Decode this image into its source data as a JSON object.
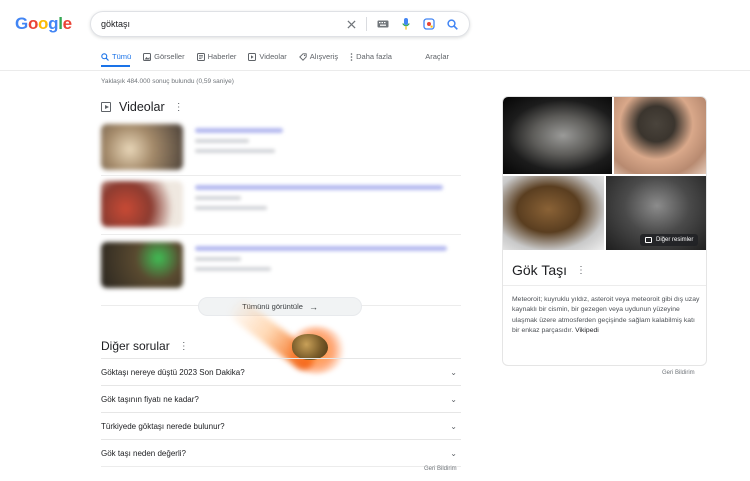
{
  "logo": {
    "letters": [
      "G",
      "o",
      "o",
      "g",
      "l",
      "e"
    ]
  },
  "search": {
    "query": "göktaşı"
  },
  "tabs": [
    {
      "label": "Tümü",
      "icon": "search-icon",
      "active": true
    },
    {
      "label": "Görseller",
      "icon": "image-icon"
    },
    {
      "label": "Haberler",
      "icon": "news-icon"
    },
    {
      "label": "Videolar",
      "icon": "video-icon"
    },
    {
      "label": "Alışveriş",
      "icon": "tag-icon"
    },
    {
      "label": "Daha fazla",
      "icon": "more-vert-icon"
    }
  ],
  "tools_label": "Araçlar",
  "result_stats": "Yaklaşık 484.000 sonuç bulundu (0,59 saniye)",
  "videos": {
    "title": "Videolar",
    "show_all_label": "Tümünü görüntüle"
  },
  "other_questions": {
    "title": "Diğer sorular",
    "items": [
      "Göktaşı nereye düştü 2023 Son Dakika?",
      "Gök taşının fiyatı ne kadar?",
      "Türkiyede göktaşı nerede bulunur?",
      "Gök taşı neden değerli?"
    ],
    "feedback_label": "Geri Bildirim"
  },
  "knowledge_panel": {
    "title": "Gök Taşı",
    "more_images_label": "Diğer resimler",
    "description": "Meteoroit; kuyruklu yıldız, asteroit veya meteoroit gibi dış uzay kaynaklı bir cismin, bir gezegen veya uydunun yüzeyine ulaşmak üzere atmosferden geçişinde sağlam kalabilmiş katı bir enkaz parçasıdır.",
    "source": "Vikipedi",
    "feedback_label": "Geri Bildirim"
  },
  "colors": {
    "link_blue": "#1a73e8",
    "text": "#202124",
    "secondary": "#5f6368"
  }
}
